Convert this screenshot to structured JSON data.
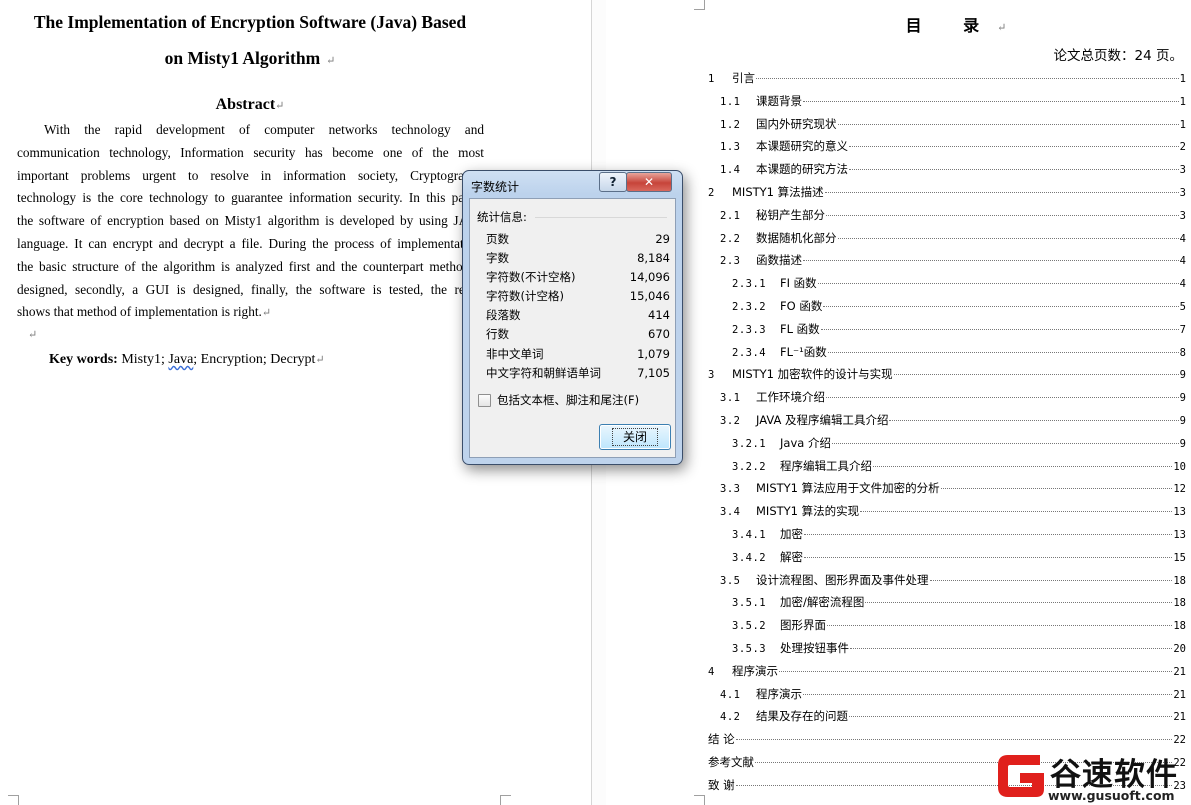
{
  "left_page": {
    "title_line1": "The Implementation of Encryption Software (Java) Based",
    "title_line2": "on Misty1 Algorithm",
    "abstract_heading": "Abstract",
    "abstract_lines": [
      "With the rapid development of computer networks technology and",
      "communication technology, Information security has become one of the most",
      "important problems urgent to resolve in information society, Cryptography",
      "technology is the core technology to guarantee information security. In this paper,",
      "the software of encryption based on Misty1 algorithm is developed by using JAVA",
      "language. It can encrypt and decrypt a file. During the process of implementation,",
      "the basic structure of the algorithm is analyzed first and the counterpart method is",
      "designed, secondly, a GUI is designed, finally, the software is tested, the result",
      "shows that method of implementation is right."
    ],
    "keywords_label": "Key words:",
    "keywords_part1": "Misty1;",
    "keywords_java": "Java",
    "keywords_part2": "; Encryption;  Decrypt",
    "para_mark": "↵"
  },
  "right_page": {
    "toc_title": "目 录",
    "page_count_label": "论文总页数：24 页。",
    "toc": [
      {
        "level": 1,
        "num": "1",
        "text": "引言",
        "page": "1"
      },
      {
        "level": 2,
        "num": "1.1",
        "text": "课题背景",
        "page": "1"
      },
      {
        "level": 2,
        "num": "1.2",
        "text": "国内外研究现状",
        "page": "1"
      },
      {
        "level": 2,
        "num": "1.3",
        "text": "本课题研究的意义",
        "page": "2"
      },
      {
        "level": 2,
        "num": "1.4",
        "text": "本课题的研究方法",
        "page": "3"
      },
      {
        "level": 1,
        "num": "2",
        "text": "MISTY1 算法描述",
        "page": "3"
      },
      {
        "level": 2,
        "num": "2.1",
        "text": "秘钥产生部分",
        "page": "3"
      },
      {
        "level": 2,
        "num": "2.2",
        "text": "数据随机化部分",
        "page": "4"
      },
      {
        "level": 2,
        "num": "2.3",
        "text": "函数描述",
        "page": "4"
      },
      {
        "level": 3,
        "num": "2.3.1",
        "text": "FI 函数",
        "page": "4"
      },
      {
        "level": 3,
        "num": "2.3.2",
        "text": "FO 函数",
        "page": "5"
      },
      {
        "level": 3,
        "num": "2.3.3",
        "text": "FL 函数",
        "page": "7"
      },
      {
        "level": 3,
        "num": "2.3.4",
        "text": "FL⁻¹函数",
        "page": "8"
      },
      {
        "level": 1,
        "num": "3",
        "text": "MISTY1 加密软件的设计与实现",
        "page": "9"
      },
      {
        "level": 2,
        "num": "3.1",
        "text": "工作环境介绍",
        "page": "9"
      },
      {
        "level": 2,
        "num": "3.2",
        "text": "JAVA 及程序编辑工具介绍",
        "page": "9"
      },
      {
        "level": 3,
        "num": "3.2.1",
        "text": "Java 介绍",
        "page": "9"
      },
      {
        "level": 3,
        "num": "3.2.2",
        "text": "程序编辑工具介绍",
        "page": "10"
      },
      {
        "level": 2,
        "num": "3.3",
        "text": "MISTY1 算法应用于文件加密的分析",
        "page": "12"
      },
      {
        "level": 2,
        "num": "3.4",
        "text": "MISTY1 算法的实现",
        "page": "13"
      },
      {
        "level": 3,
        "num": "3.4.1",
        "text": "加密",
        "page": "13"
      },
      {
        "level": 3,
        "num": "3.4.2",
        "text": "解密",
        "page": "15"
      },
      {
        "level": 2,
        "num": "3.5",
        "text": "设计流程图、图形界面及事件处理",
        "page": "18"
      },
      {
        "level": 3,
        "num": "3.5.1",
        "text": "加密/解密流程图",
        "page": "18"
      },
      {
        "level": 3,
        "num": "3.5.2",
        "text": "图形界面",
        "page": "18"
      },
      {
        "level": 3,
        "num": "3.5.3",
        "text": "处理按钮事件",
        "page": "20"
      },
      {
        "level": 1,
        "num": "4",
        "text": "程序演示",
        "page": "21"
      },
      {
        "level": 2,
        "num": "4.1",
        "text": "程序演示",
        "page": "21"
      },
      {
        "level": 2,
        "num": "4.2",
        "text": "结果及存在的问题",
        "page": "21"
      },
      {
        "level": 1,
        "num": "",
        "text": "结    论",
        "page": "22"
      },
      {
        "level": 1,
        "num": "",
        "text": "参考文献",
        "page": "22"
      },
      {
        "level": 1,
        "num": "",
        "text": "致    谢",
        "page": "23"
      }
    ]
  },
  "dialog": {
    "title": "字数统计",
    "help_label": "?",
    "close_x_label": "✕",
    "stats_header": "统计信息:",
    "stats": [
      {
        "label": "页数",
        "value": "29"
      },
      {
        "label": "字数",
        "value": "8,184"
      },
      {
        "label": "字符数(不计空格)",
        "value": "14,096"
      },
      {
        "label": "字符数(计空格)",
        "value": "15,046"
      },
      {
        "label": "段落数",
        "value": "414"
      },
      {
        "label": "行数",
        "value": "670"
      },
      {
        "label": "非中文单词",
        "value": "1,079"
      },
      {
        "label": "中文字符和朝鲜语单词",
        "value": "7,105"
      }
    ],
    "include_label": "包括文本框、脚注和尾注(F)",
    "include_checked": false,
    "close_button_label": "关闭"
  },
  "watermark": {
    "brand": "谷速软件",
    "url": "www.gusuoft.com",
    "brand_color": "#e0201c"
  }
}
